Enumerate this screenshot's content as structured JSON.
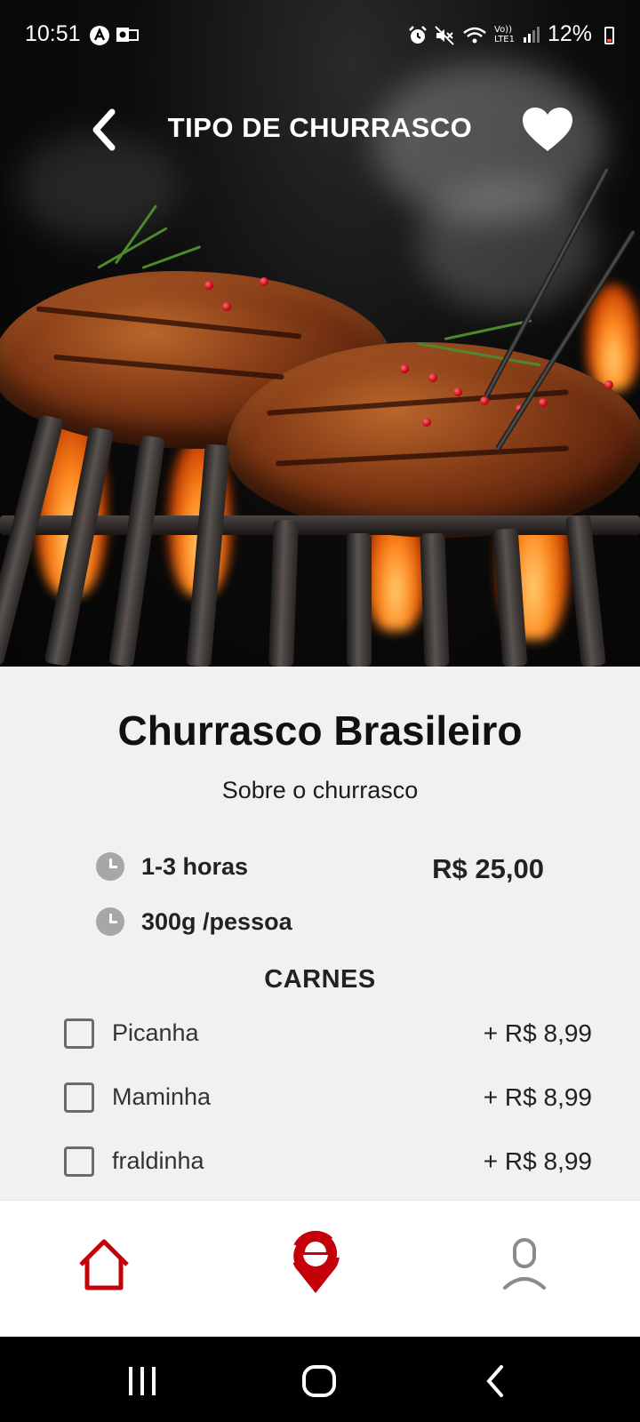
{
  "status_bar": {
    "time": "10:51",
    "battery": "12%",
    "icons": [
      "a-notification-icon",
      "outlook-icon",
      "alarm-icon",
      "mute-icon",
      "wifi-icon",
      "volte-icon",
      "signal-icon",
      "battery-icon"
    ],
    "volte_text": "Vo)) LTE1"
  },
  "header": {
    "title": "TIPO DE CHURRASCO",
    "back_icon": "chevron-left-icon",
    "favorite_icon": "heart-icon"
  },
  "product": {
    "title": "Churrasco Brasileiro",
    "subtitle": "Sobre o churrasco",
    "duration": "1-3 horas",
    "portion": "300g /pessoa",
    "price": "R$ 25,00"
  },
  "meats": {
    "section_title": "CARNES",
    "items": [
      {
        "label": "Picanha",
        "price": "+ R$ 8,99",
        "checked": false
      },
      {
        "label": "Maminha",
        "price": "+ R$ 8,99",
        "checked": false
      },
      {
        "label": "fraldinha",
        "price": "+ R$ 8,99",
        "checked": false
      }
    ]
  },
  "bottom_nav": {
    "items": [
      {
        "icon": "home-icon",
        "active": true
      },
      {
        "icon": "grill-location-icon",
        "active": true
      },
      {
        "icon": "user-icon",
        "active": false
      }
    ],
    "accent_color": "#c4000b",
    "inactive_color": "#8a8a8a"
  },
  "system_nav": {
    "icons": [
      "recent-apps-icon",
      "home-circle-icon",
      "back-icon"
    ]
  }
}
